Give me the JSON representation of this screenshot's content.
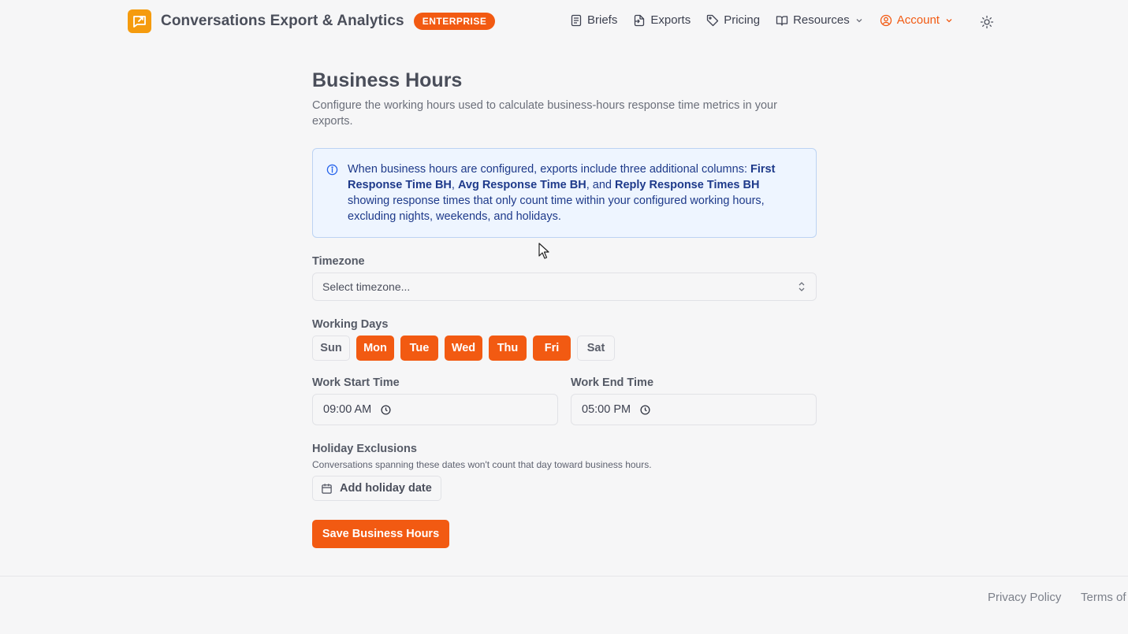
{
  "header": {
    "app_title": "Conversations Export & Analytics",
    "badge": "ENTERPRISE",
    "nav": [
      {
        "label": "Briefs",
        "icon": "document-icon"
      },
      {
        "label": "Exports",
        "icon": "export-icon"
      },
      {
        "label": "Pricing",
        "icon": "tag-icon"
      },
      {
        "label": "Resources",
        "icon": "book-icon"
      },
      {
        "label": "Account",
        "icon": "user-circle-icon"
      }
    ],
    "theme_icon": "sun-icon"
  },
  "main": {
    "title": "Business Hours",
    "description": "Configure the working hours used to calculate business-hours response time metrics in your exports.",
    "info": {
      "prefix": "When business hours are configured, exports include three additional columns: ",
      "col1": "First Response Time BH",
      "sep1": ", ",
      "col2": "Avg Response Time BH",
      "sep2": ", and ",
      "col3": "Reply Response Times BH",
      "suffix": " showing response times that only count time within your configured working hours, excluding nights, weekends, and holidays."
    },
    "timezone": {
      "label": "Timezone",
      "placeholder": "Select timezone..."
    },
    "working_days": {
      "label": "Working Days",
      "days": [
        {
          "label": "Sun",
          "selected": false
        },
        {
          "label": "Mon",
          "selected": true
        },
        {
          "label": "Tue",
          "selected": true
        },
        {
          "label": "Wed",
          "selected": true
        },
        {
          "label": "Thu",
          "selected": true
        },
        {
          "label": "Fri",
          "selected": true
        },
        {
          "label": "Sat",
          "selected": false
        }
      ]
    },
    "start_time": {
      "label": "Work Start Time",
      "value": "09:00 AM"
    },
    "end_time": {
      "label": "Work End Time",
      "value": "05:00 PM"
    },
    "holiday": {
      "label": "Holiday Exclusions",
      "hint": "Conversations spanning these dates won't count that day toward business hours.",
      "add_label": "Add holiday date"
    },
    "save_label": "Save Business Hours"
  },
  "footer": {
    "privacy": "Privacy Policy",
    "terms": "Terms of"
  },
  "colors": {
    "accent": "#f25a12",
    "logo": "#f59b0e",
    "info_bg": "#eef5ff",
    "info_text": "#1e3a8a"
  }
}
